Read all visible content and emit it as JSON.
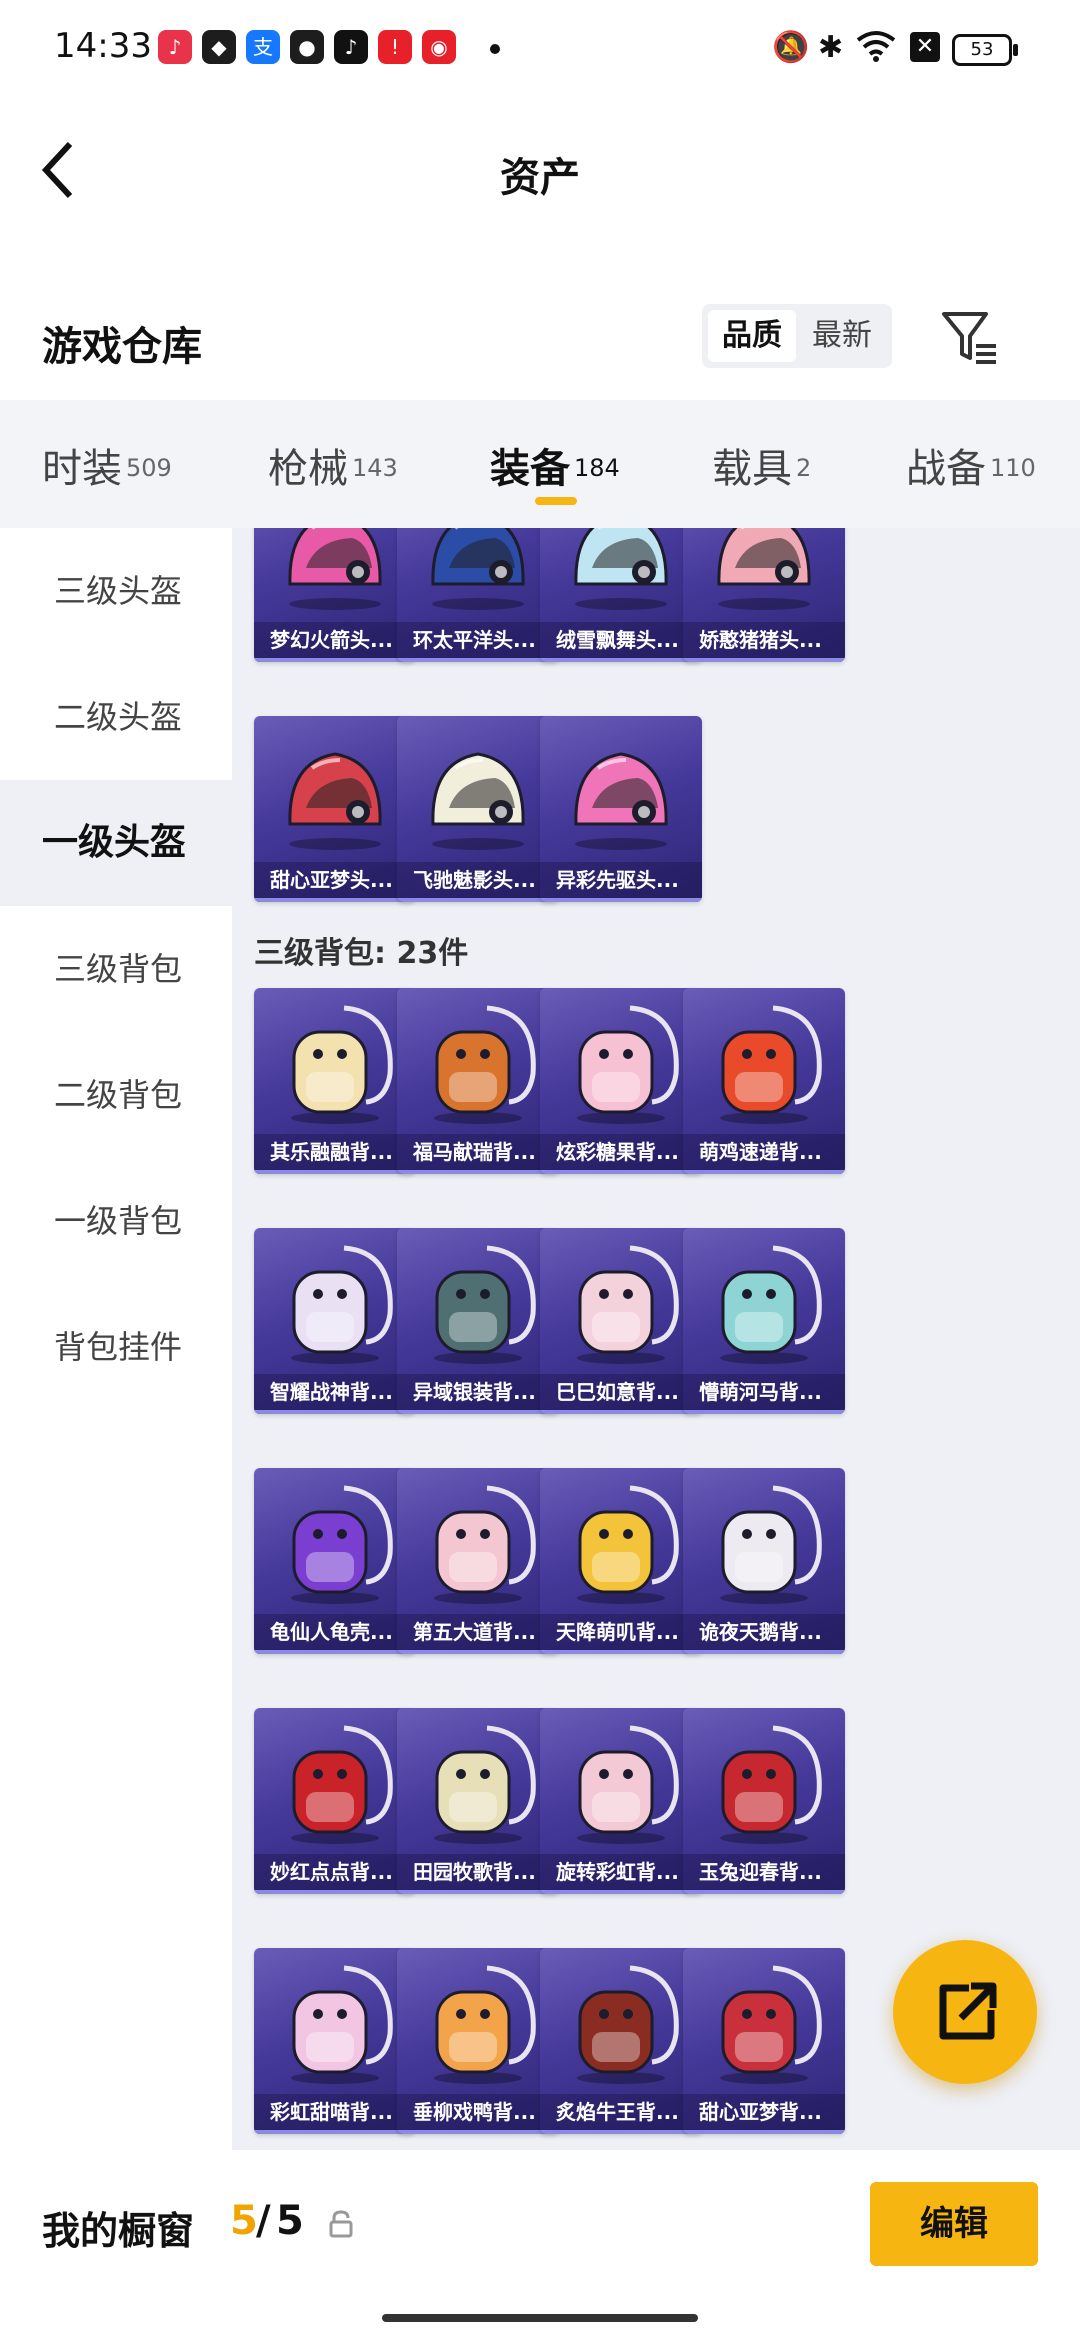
{
  "status_bar": {
    "time": "14:33",
    "battery": "53",
    "app_icons": [
      {
        "name": "music-app-icon",
        "color": "#e8334a",
        "glyph": "♪"
      },
      {
        "name": "shield-app-icon",
        "color": "#1d1d1d",
        "glyph": "◆"
      },
      {
        "name": "alipay-app-icon",
        "color": "#1677ff",
        "glyph": "支"
      },
      {
        "name": "wechat-app-icon",
        "color": "#1d1d1d",
        "glyph": "●"
      },
      {
        "name": "tiktok-app-icon",
        "color": "#111111",
        "glyph": "♪"
      },
      {
        "name": "red-app-icon",
        "color": "#e8202a",
        "glyph": "!"
      },
      {
        "name": "shop-app-icon",
        "color": "#e8202a",
        "glyph": "◉"
      }
    ]
  },
  "header": {
    "title": "资产"
  },
  "section": {
    "title": "游戏仓库",
    "sort_quality": "品质",
    "sort_newest": "最新"
  },
  "tabs": [
    {
      "label": "时装",
      "count": "509"
    },
    {
      "label": "枪械",
      "count": "143"
    },
    {
      "label": "装备",
      "count": "184"
    },
    {
      "label": "载具",
      "count": "2"
    },
    {
      "label": "战备",
      "count": "110"
    }
  ],
  "sidebar": {
    "items": [
      "三级头盔",
      "二级头盔",
      "一级头盔",
      "三级背包",
      "二级背包",
      "一级背包",
      "背包挂件"
    ],
    "active_index": 2
  },
  "helmets": [
    {
      "name": "梦幻火箭头...",
      "icon": "pink-rocket-helmet",
      "color": "#e85aa8"
    },
    {
      "name": "环太平洋头...",
      "icon": "blue-mech-helmet",
      "color": "#2b4da8"
    },
    {
      "name": "绒雪飘舞头...",
      "icon": "white-snow-helmet",
      "color": "#bfe4f2"
    },
    {
      "name": "娇憨猪猪头...",
      "icon": "pink-pig-helmet",
      "color": "#f2a9b6"
    },
    {
      "name": "甜心亚梦头...",
      "icon": "red-sweet-helmet",
      "color": "#d7414c"
    },
    {
      "name": "飞驰魅影头...",
      "icon": "white-racer-helmet",
      "color": "#f1eedc"
    },
    {
      "name": "异彩先驱头...",
      "icon": "pink-pioneer-helmet",
      "color": "#ef74b8"
    }
  ],
  "backpack_group": {
    "title": "三级背包: 23件"
  },
  "backpacks": [
    {
      "name": "其乐融融背...",
      "icon": "bunny-backpack",
      "color": "#f3e1b0"
    },
    {
      "name": "福马献瑞背...",
      "icon": "horse-backpack",
      "color": "#d9742e"
    },
    {
      "name": "炫彩糖果背...",
      "icon": "candy-backpack",
      "color": "#f6c1d3"
    },
    {
      "name": "萌鸡速递背...",
      "icon": "chicken-backpack",
      "color": "#e84a2a"
    },
    {
      "name": "智耀战神背...",
      "icon": "armor-backpack",
      "color": "#e9e0f4"
    },
    {
      "name": "异域银装背...",
      "icon": "silver-backpack",
      "color": "#4f6f73"
    },
    {
      "name": "巳巳如意背...",
      "icon": "snake-backpack",
      "color": "#f4d2dc"
    },
    {
      "name": "懵萌河马背...",
      "icon": "hippo-backpack",
      "color": "#8fd4d4"
    },
    {
      "name": "龟仙人龟壳...",
      "icon": "turtle-shell-backpack",
      "color": "#7a3fd0"
    },
    {
      "name": "第五大道背...",
      "icon": "pink-bag-backpack",
      "color": "#f4c6d2"
    },
    {
      "name": "天降萌叽背...",
      "icon": "yellow-backpack",
      "color": "#f3c33a"
    },
    {
      "name": "诡夜天鹅背...",
      "icon": "swan-backpack",
      "color": "#eeeaf2"
    },
    {
      "name": "妙红点点背...",
      "icon": "ladybug-backpack",
      "color": "#c92228"
    },
    {
      "name": "田园牧歌背...",
      "icon": "basket-backpack",
      "color": "#e7dfb8"
    },
    {
      "name": "旋转彩虹背...",
      "icon": "teapot-backpack",
      "color": "#f3c9d6"
    },
    {
      "name": "玉兔迎春背...",
      "icon": "red-rabbit-backpack",
      "color": "#c7282f"
    },
    {
      "name": "彩虹甜喵背...",
      "icon": "cat-backpack",
      "color": "#f2c6e3"
    },
    {
      "name": "垂柳戏鸭背...",
      "icon": "duck-backpack",
      "color": "#f3a34a"
    },
    {
      "name": "炙焰牛王背...",
      "icon": "bull-backpack",
      "color": "#8a2c22"
    },
    {
      "name": "甜心亚梦背...",
      "icon": "sweet-backpack",
      "color": "#c9303c"
    }
  ],
  "bottom_bar": {
    "showcase_label": "我的橱窗",
    "count_current": "5",
    "count_separator": "/",
    "count_max": "5",
    "edit_label": "编辑"
  },
  "colors": {
    "accent": "#f7b512",
    "card": "#45399a"
  }
}
